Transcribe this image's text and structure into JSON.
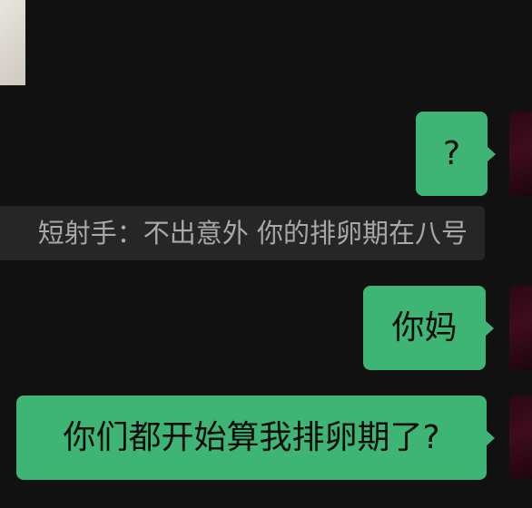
{
  "messages": [
    {
      "text": "?",
      "sender": "self"
    },
    {
      "quote_text": "短射手：不出意外 你的排卵期在八号"
    },
    {
      "text": "你妈",
      "sender": "self"
    },
    {
      "text": "你们都开始算我排卵期了?",
      "sender": "self"
    }
  ],
  "colors": {
    "background": "#111111",
    "self_bubble": "#3eb575",
    "quote_background": "#262626",
    "quote_text": "#a8a8a8"
  }
}
